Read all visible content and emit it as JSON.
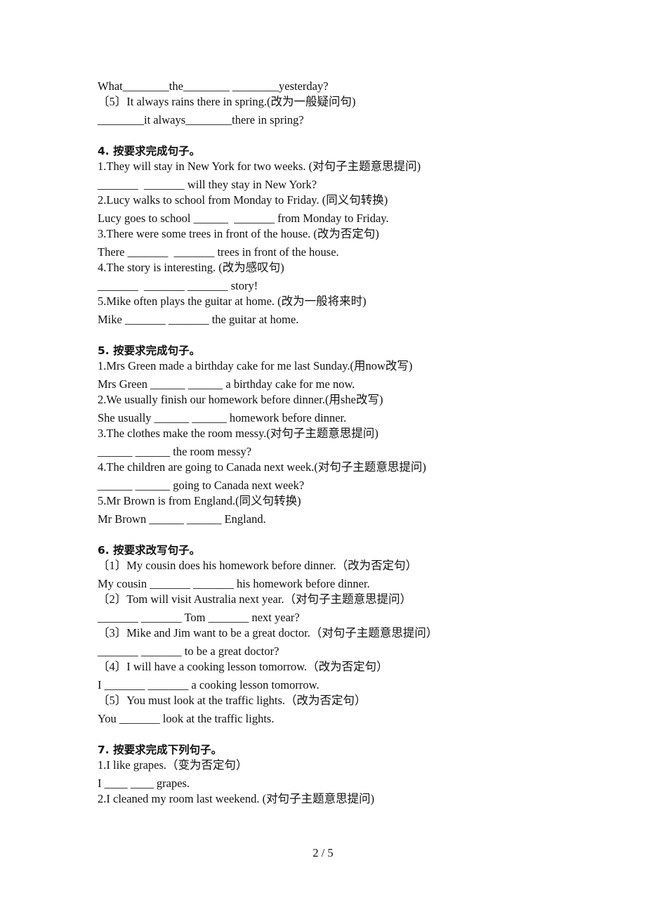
{
  "continuation": {
    "lines": [
      {
        "type": "answer",
        "text": "What________the________ ________yesterday?"
      },
      {
        "type": "question",
        "text": "〔5〕It always rains there in spring.(改为一般疑问句)"
      },
      {
        "type": "answer",
        "text": "________it always________there in spring?"
      }
    ]
  },
  "sections": [
    {
      "heading": "4.  按要求完成句子。",
      "lines": [
        {
          "type": "question",
          "text": "1.They will stay in New York for two weeks. (对句子主题意思提问)"
        },
        {
          "type": "answer",
          "text": "_______  _______ will they stay in New York?"
        },
        {
          "type": "question",
          "text": "2.Lucy walks to school from Monday to Friday. (同义句转换)"
        },
        {
          "type": "answer",
          "text": "Lucy goes to school ______  _______ from Monday to Friday."
        },
        {
          "type": "question",
          "text": "3.There were some trees in front of the house. (改为否定句)"
        },
        {
          "type": "answer",
          "text": "There _______  _______ trees in front of the house."
        },
        {
          "type": "question",
          "text": "4.The story is interesting. (改为感叹句)"
        },
        {
          "type": "answer",
          "text": "_______  _______ _______ story!"
        },
        {
          "type": "question",
          "text": "5.Mike often plays the guitar at home. (改为一般将来时)"
        },
        {
          "type": "answer",
          "text": "Mike _______ _______ the guitar at home."
        }
      ]
    },
    {
      "heading": "5.  按要求完成句子。",
      "lines": [
        {
          "type": "question",
          "text": "1.Mrs Green made a birthday cake for me last Sunday.(用now改写)"
        },
        {
          "type": "answer",
          "text": "Mrs Green ______ ______ a birthday cake for me now."
        },
        {
          "type": "question",
          "text": "2.We usually finish our homework before dinner.(用she改写)"
        },
        {
          "type": "answer",
          "text": "She usually ______ ______ homework before dinner."
        },
        {
          "type": "question",
          "text": "3.The clothes make the room messy.(对句子主题意思提问)"
        },
        {
          "type": "answer",
          "text": "______ ______ the room messy?"
        },
        {
          "type": "question",
          "text": "4.The children are going to Canada next week.(对句子主题意思提问)"
        },
        {
          "type": "answer",
          "text": "______ ______ going to Canada next week?"
        },
        {
          "type": "question",
          "text": "5.Mr Brown is from England.(同义句转换)"
        },
        {
          "type": "answer",
          "text": "Mr Brown ______ ______ England."
        }
      ]
    },
    {
      "heading": "6.  按要求改写句子。",
      "lines": [
        {
          "type": "question",
          "text": "〔1〕My cousin does his homework before dinner.（改为否定句）"
        },
        {
          "type": "answer",
          "text": "My cousin _______ _______ his homework before dinner."
        },
        {
          "type": "question",
          "text": "〔2〕Tom will visit Australia next year.（对句子主题意思提问）"
        },
        {
          "type": "answer",
          "text": "_______ _______ Tom _______ next year?"
        },
        {
          "type": "question",
          "text": "〔3〕Mike and Jim want to be a great doctor.（对句子主题意思提问）"
        },
        {
          "type": "answer",
          "text": "_______ _______ to be a great doctor?"
        },
        {
          "type": "question",
          "text": "〔4〕I will have a cooking lesson tomorrow.（改为否定句）"
        },
        {
          "type": "answer",
          "text": "I _______ _______ a cooking lesson tomorrow."
        },
        {
          "type": "question",
          "text": "〔5〕You must look at the traffic lights.（改为否定句）"
        },
        {
          "type": "answer",
          "text": "You _______ look at the traffic lights."
        }
      ]
    },
    {
      "heading": "7.  按要求完成下列句子。",
      "lines": [
        {
          "type": "question",
          "text": "1.I like grapes.（变为否定句）"
        },
        {
          "type": "answer",
          "text": "I ____ ____ grapes."
        },
        {
          "type": "question",
          "text": "2.I cleaned my room last weekend. (对句子主题意思提问)"
        }
      ]
    }
  ],
  "footer": {
    "page_number": "2 / 5"
  }
}
